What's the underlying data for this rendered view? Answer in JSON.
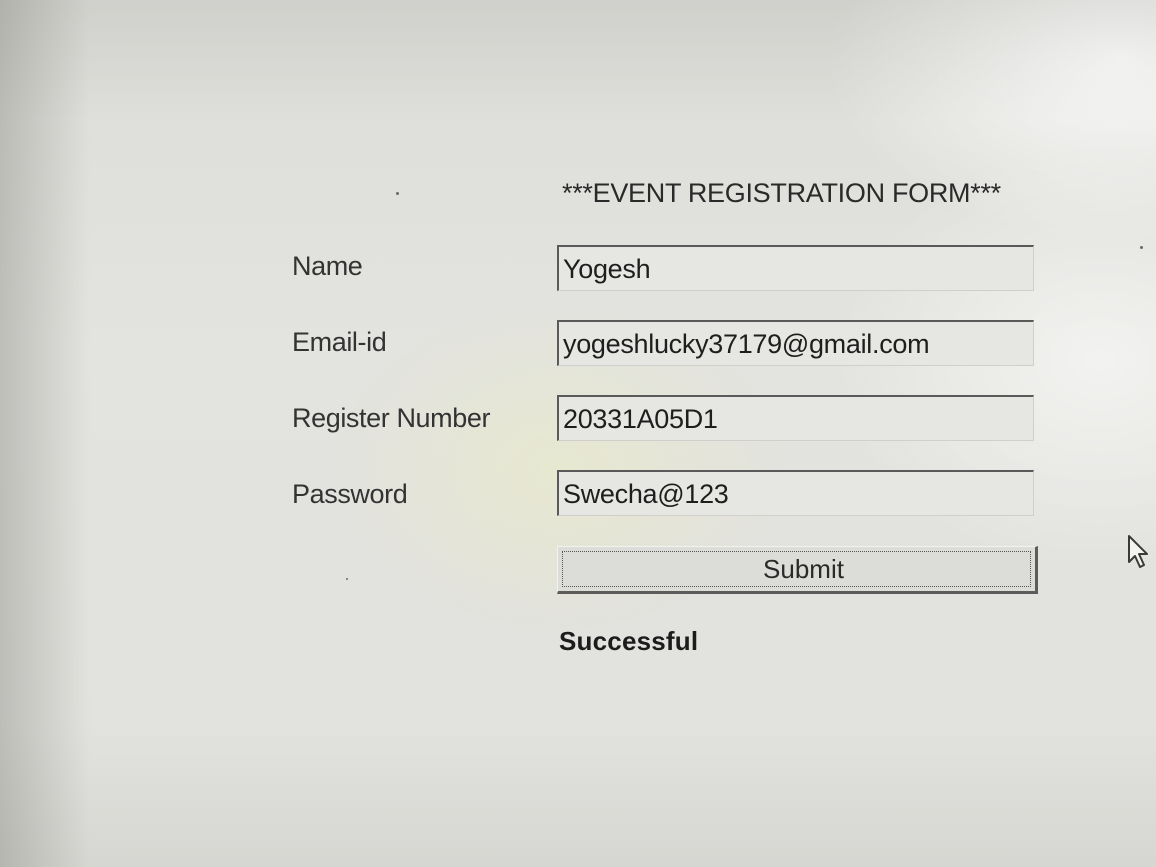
{
  "form": {
    "title": "***EVENT REGISTRATION FORM***",
    "fields": [
      {
        "label": "Name",
        "value": "Yogesh"
      },
      {
        "label": "Email-id",
        "value": "yogeshlucky37179@gmail.com"
      },
      {
        "label": "Register Number",
        "value": "20331A05D1"
      },
      {
        "label": "Password",
        "value": "Swecha@123"
      }
    ],
    "submit_label": "Submit",
    "status_message": "Successful"
  },
  "icons": {
    "cursor": "mouse-pointer-icon"
  }
}
